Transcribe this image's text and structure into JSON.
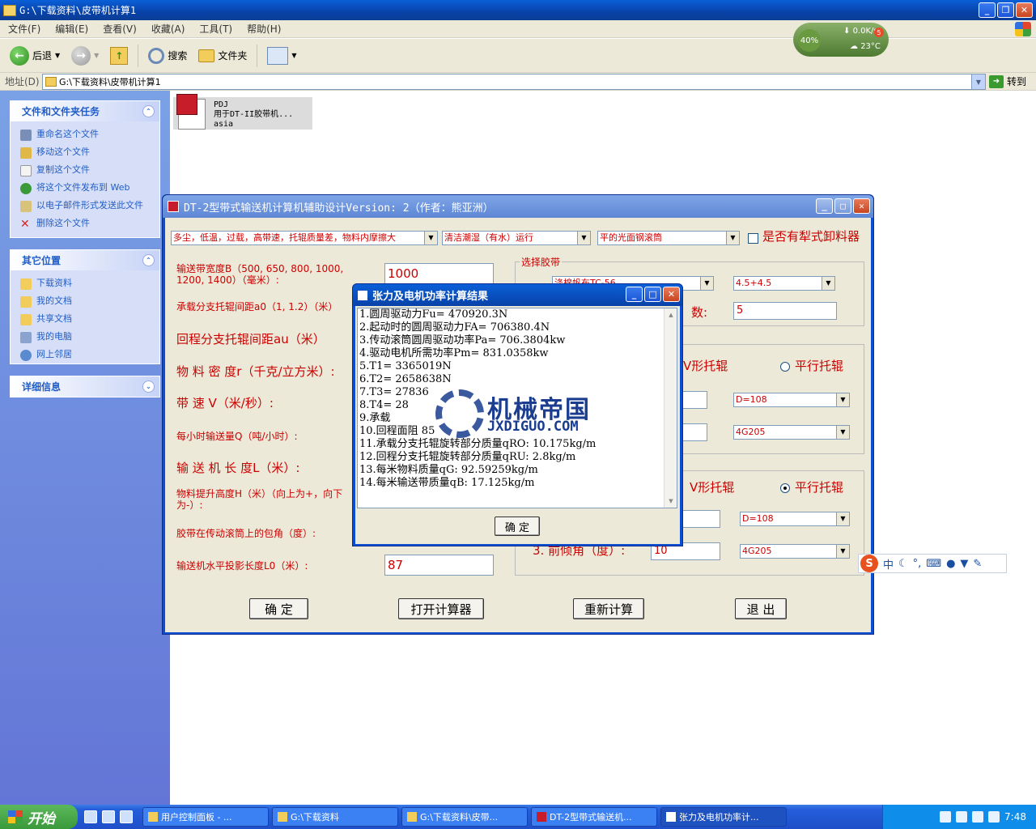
{
  "explorer": {
    "title": "G:\\下载资料\\皮带机计算1",
    "menu": [
      "文件(F)",
      "编辑(E)",
      "查看(V)",
      "收藏(A)",
      "工具(T)",
      "帮助(H)"
    ],
    "toolbar": {
      "back": "后退",
      "search": "搜索",
      "folders": "文件夹"
    },
    "address_label": "地址(D)",
    "address_value": "G:\\下载资料\\皮带机计算1",
    "goto": "转到",
    "file": {
      "line1": "PDJ",
      "line2": "用于DT-II胶带机...",
      "line3": "asia"
    }
  },
  "gadget": {
    "cpu": "40%",
    "speed": "0.0K/s",
    "temp": "23°C",
    "badge": "5"
  },
  "leftpane": {
    "tasks_title": "文件和文件夹任务",
    "tasks": [
      "重命名这个文件",
      "移动这个文件",
      "复制这个文件",
      "将这个文件发布到 Web",
      "以电子邮件形式发送此文件",
      "删除这个文件"
    ],
    "places_title": "其它位置",
    "places": [
      "下载资料",
      "我的文档",
      "共享文档",
      "我的电脑",
      "网上邻居"
    ],
    "details_title": "详细信息"
  },
  "app": {
    "title": "DT-2型带式输送机计算机辅助设计Version: 2（作者：熊亚洲）",
    "combo1": "多尘，低温，过载，高带速，托辊质量差，物料内摩擦大",
    "combo2": "清洁潮湿（有水）运行",
    "combo3": "平的光面钢滚筒",
    "plow_label": "是否有犁式卸料器",
    "belt_width_label": "输送带宽度B（500, 650, 800, 1000, 1200, 1400）（毫米）:",
    "belt_width_value": "1000",
    "carry_idler_label": "承载分支托辊间距a0（1, 1.2）（米）",
    "return_idler_label": "回程分支托辊间距au（米）",
    "density_label": "物 料 密 度r（千克/立方米）:",
    "speed_label": "带     速  V（米/秒）:",
    "capacity_label": "每小时输送量Q（吨/小时）:",
    "length_label": "输 送 机 长 度L（米）:",
    "lift_label": "物料提升高度H（米）（向上为+，向下为-）:",
    "wrap_label": "胶带在传动滚筒上的包角（度）:",
    "proj_label": "输送机水平投影长度L0（米）:",
    "proj_value": "87",
    "group_belt": "选择胶带",
    "belt_type": "涤棉帆布TC-56",
    "belt_cover": "4.5+4.5",
    "layers_label": "数:",
    "layers_value": "5",
    "radio_v1": "V形托辊",
    "radio_p1": "平行托辊",
    "combo_d1": "D=108",
    "combo_g1": "4G205",
    "radio_v2": "V形托辊",
    "radio_p2": "平行托辊",
    "combo_d2": "D=108",
    "front_tilt_label": "3.  前倾角（度）:",
    "front_tilt_value": "10",
    "combo_g2": "4G205",
    "btn_ok": "确  定",
    "btn_calc": "打开计算器",
    "btn_recalc": "重新计算",
    "btn_exit": "退 出"
  },
  "dialog": {
    "title": "张力及电机功率计算结果",
    "lines": [
      "1.圆周驱动力Fu= 470920.3N",
      "2.起动时的圆周驱动力FA= 706380.4N",
      "3.传动滚筒圆周驱动功率Pa= 706.3804kw",
      "4.驱动电机所需功率Pm= 831.0358kw",
      "5.T1= 3365019N",
      "6.T2= 2658638N",
      "7.T3= 27836",
      "8.T4= 28",
      "9.承载",
      "10.回程面阻    85",
      "11.承载分支托辊旋转部分质量qRO:  10.175kg/m",
      "12.回程分支托辊旋转部分质量qRU:  2.8kg/m",
      "13.每米物料质量qG:  92.59259kg/m",
      "14.每米输送带质量qB:  17.125kg/m"
    ],
    "ok": "确 定"
  },
  "watermark": {
    "cn": "机械帝国",
    "en": "JXDIGUO.COM"
  },
  "ime": {
    "zh": "中"
  },
  "taskbar": {
    "start": "开始",
    "tasks": [
      "用户控制面板 - ...",
      "G:\\下载资料",
      "G:\\下载资料\\皮带...",
      "DT-2型带式输送机...",
      "张力及电机功率计..."
    ],
    "clock": "7:48"
  }
}
